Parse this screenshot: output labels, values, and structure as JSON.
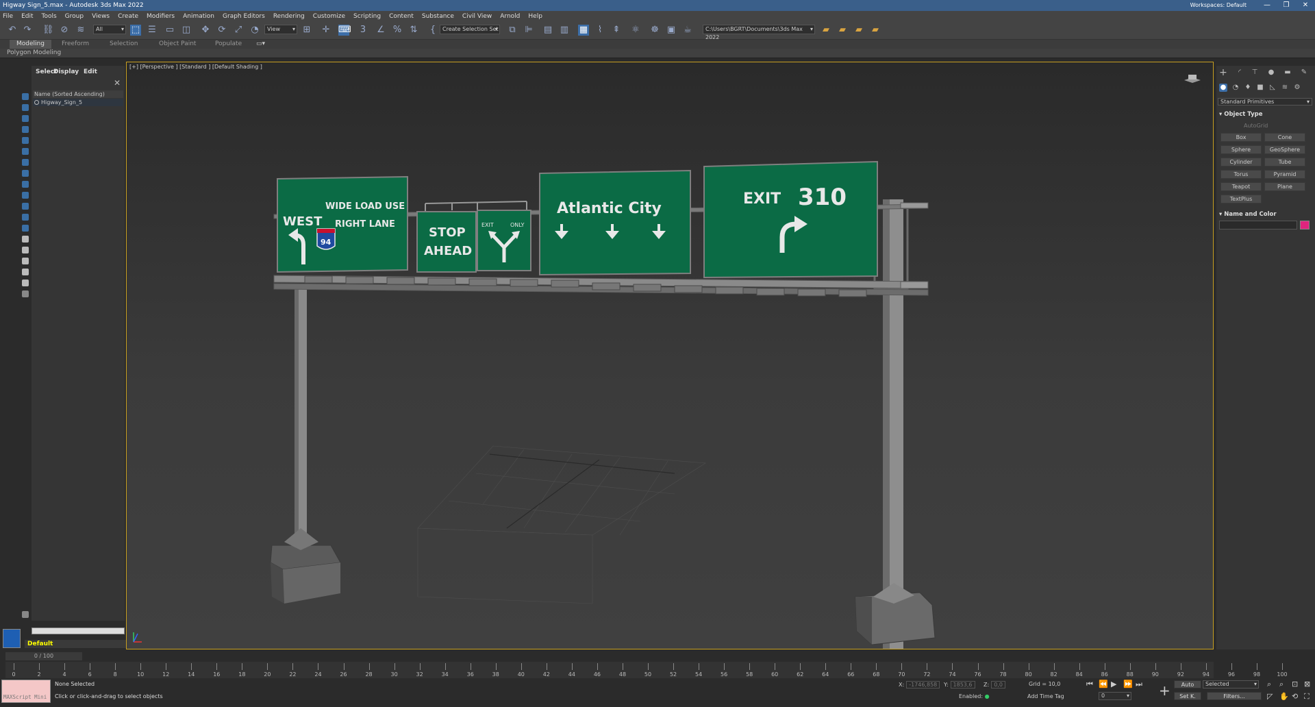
{
  "window": {
    "title": "Higway Sign_5.max - Autodesk 3ds Max 2022",
    "workspace_label": "Workspaces:",
    "workspace_value": "Default",
    "minimize": "—",
    "maximize": "❐",
    "close": "✕"
  },
  "menu": [
    "File",
    "Edit",
    "Tools",
    "Group",
    "Views",
    "Create",
    "Modifiers",
    "Animation",
    "Graph Editors",
    "Rendering",
    "Customize",
    "Scripting",
    "Content",
    "Substance",
    "Civil View",
    "Arnold",
    "Help"
  ],
  "toolbar": {
    "selection_filter": "All",
    "ref_coord": "View",
    "selection_set": "Create Selection Set",
    "project_path": "C:\\Users\\BGRT\\Documents\\3ds Max 2022"
  },
  "ribbon": {
    "tabs": [
      "Modeling",
      "Freeform",
      "Selection",
      "Object Paint",
      "Populate"
    ],
    "active_tab": "Modeling",
    "sub_label": "Polygon Modeling"
  },
  "explorer": {
    "tabs": [
      "Select",
      "Display",
      "Edit"
    ],
    "column_header": "Name (Sorted Ascending)",
    "items": [
      "Higway_Sign_5"
    ],
    "layer": "Default"
  },
  "viewport": {
    "label": "[+] [Perspective ] [Standard ] [Default Shading ]",
    "signs": {
      "sign1_west": "WEST",
      "sign1_line1": "WIDE LOAD USE",
      "sign1_line2": "RIGHT LANE",
      "sign1_shield": "94",
      "sign2_line1": "STOP",
      "sign2_line2": "AHEAD",
      "sign3_left": "EXIT",
      "sign3_right": "ONLY",
      "sign4": "Atlantic City",
      "sign5_exit": "EXIT",
      "sign5_number": "310"
    },
    "colors": {
      "sign_green": "#0b6b45",
      "sign_text": "#e8e8e8"
    }
  },
  "command_panel": {
    "category": "Standard Primitives",
    "object_type_title": "Object Type",
    "autogrid": "AutoGrid",
    "primitives": [
      "Box",
      "Cone",
      "Sphere",
      "GeoSphere",
      "Cylinder",
      "Tube",
      "Torus",
      "Pyramid",
      "Teapot",
      "Plane",
      "TextPlus"
    ],
    "name_color_title": "Name and Color",
    "swatch_color": "#e0247e"
  },
  "timeline": {
    "slider": "0 / 100",
    "ticks": [
      "0",
      "2",
      "4",
      "6",
      "8",
      "10",
      "12",
      "14",
      "16",
      "18",
      "20",
      "22",
      "24",
      "26",
      "28",
      "30",
      "32",
      "34",
      "36",
      "38",
      "40",
      "42",
      "44",
      "46",
      "48",
      "50",
      "52",
      "54",
      "56",
      "58",
      "60",
      "62",
      "64",
      "66",
      "68",
      "70",
      "72",
      "74",
      "76",
      "78",
      "80",
      "82",
      "84",
      "86",
      "88",
      "90",
      "92",
      "94",
      "96",
      "98",
      "100"
    ]
  },
  "status": {
    "maxscript_label": "MAXScript Mini",
    "selection": "None Selected",
    "prompt": "Click or click-and-drag to select objects",
    "x_label": "X:",
    "x_value": "-1746,858",
    "y_label": "Y:",
    "y_value": "1853,6",
    "z_label": "Z:",
    "z_value": "0,0",
    "grid": "Grid = 10,0",
    "enabled": "Enabled:",
    "add_time_tag": "Add Time Tag",
    "auto": "Auto",
    "setk": "Set K.",
    "key_filter": "Selected",
    "filters": "Filters...",
    "frame": "0"
  }
}
